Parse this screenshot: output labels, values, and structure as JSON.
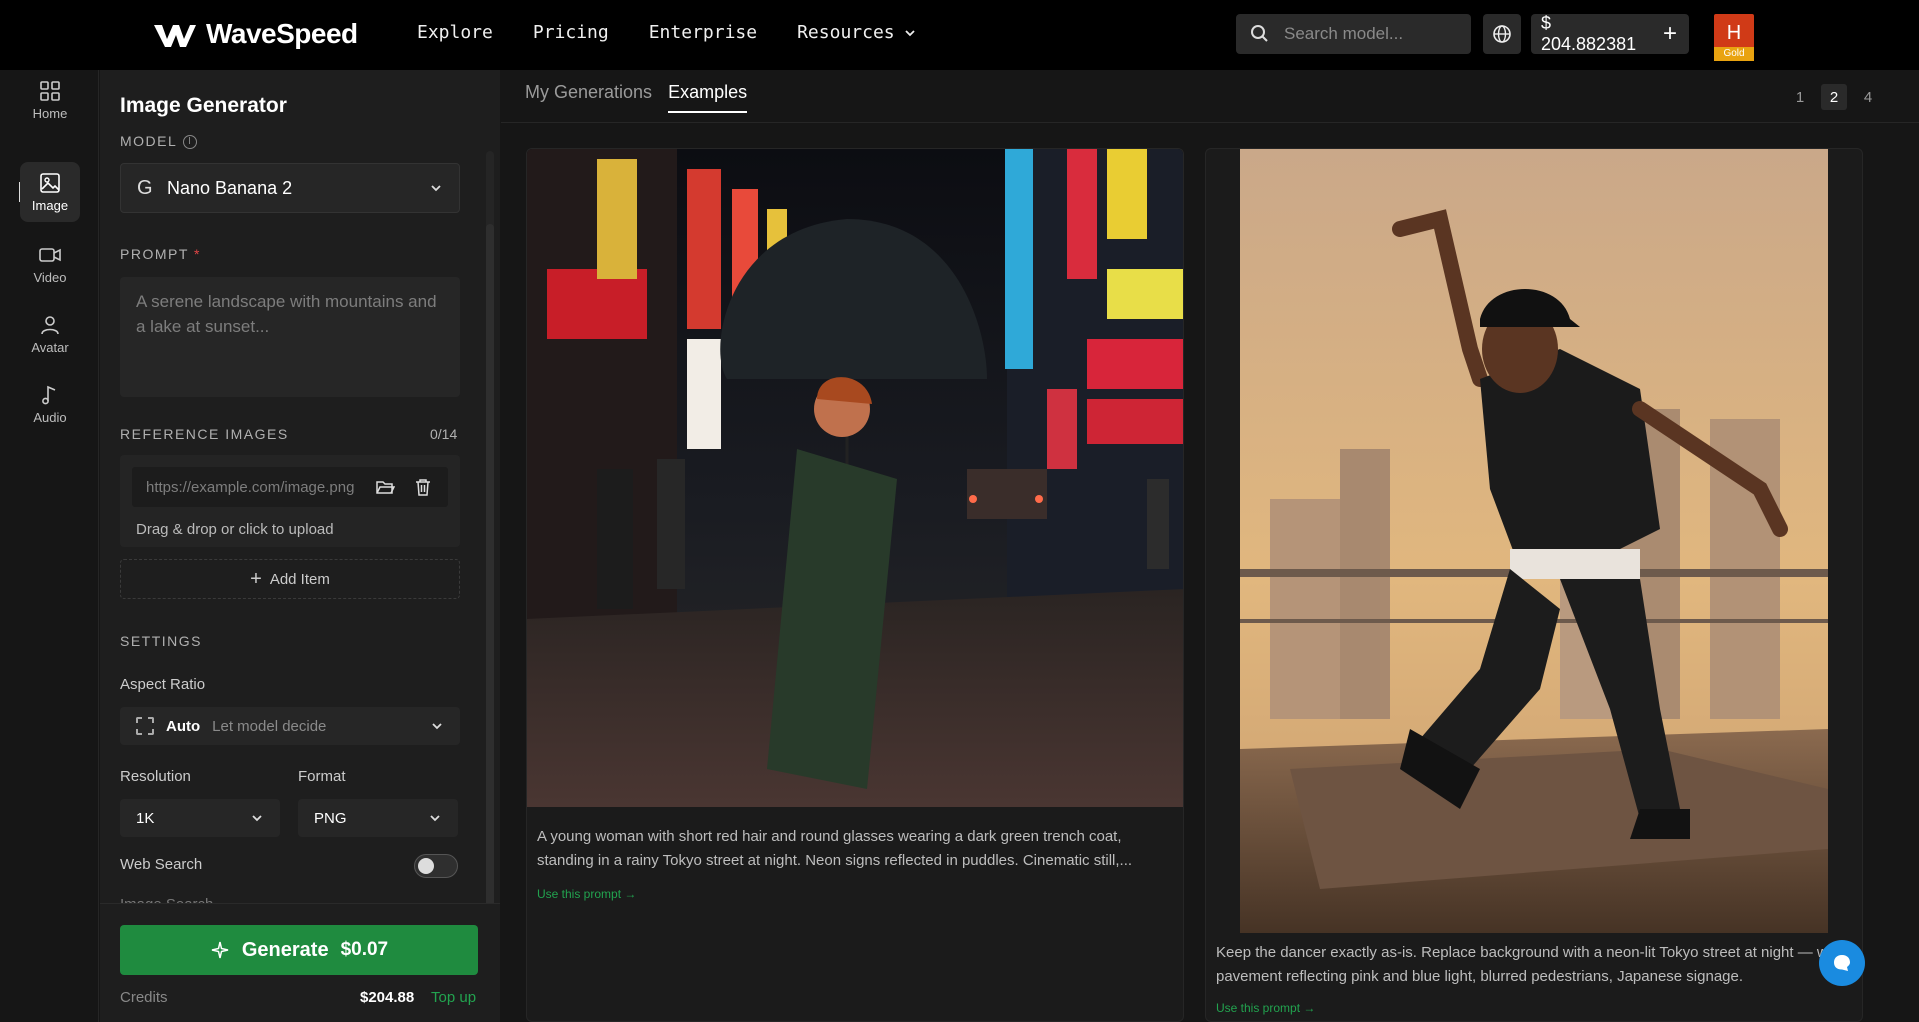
{
  "header": {
    "brand": "WaveSpeed",
    "nav": [
      {
        "label": "Explore"
      },
      {
        "label": "Pricing"
      },
      {
        "label": "Enterprise"
      },
      {
        "label": "Resources"
      }
    ],
    "search_placeholder": "Search model...",
    "balance": "$ 204.882381",
    "avatar_letter": "H",
    "avatar_badge": "Gold"
  },
  "sidenav": [
    {
      "label": "Home",
      "icon": "grid-icon"
    },
    {
      "label": "Image",
      "icon": "image-icon",
      "active": true
    },
    {
      "label": "Video",
      "icon": "video-icon"
    },
    {
      "label": "Avatar",
      "icon": "user-icon"
    },
    {
      "label": "Audio",
      "icon": "music-icon"
    }
  ],
  "panel": {
    "title": "Image Generator",
    "model_label": "MODEL",
    "model_icon": "G",
    "model_value": "Nano Banana 2",
    "prompt_label": "PROMPT",
    "prompt_required": "*",
    "prompt_placeholder": "A serene landscape with mountains and a lake at sunset...",
    "ref_label": "REFERENCE IMAGES",
    "ref_count": "0/14",
    "ref_url_placeholder": "https://example.com/image.png",
    "ref_drag_text": "Drag & drop or click to upload",
    "add_item": "Add Item",
    "settings_label": "SETTINGS",
    "aspect_label": "Aspect Ratio",
    "aspect_value": "Auto",
    "aspect_sub": "Let model decide",
    "resolution_label": "Resolution",
    "resolution_value": "1K",
    "format_label": "Format",
    "format_value": "PNG",
    "web_search_label": "Web Search",
    "web_search_enabled": false,
    "next_toggle_label": "Image Search",
    "generate_label": "Generate",
    "generate_price": "$0.07",
    "credits_label": "Credits",
    "credits_value": "$204.88",
    "topup_label": "Top up"
  },
  "main": {
    "tabs": [
      {
        "label": "My Generations"
      },
      {
        "label": "Examples",
        "active": true
      }
    ],
    "pages": [
      "1",
      "2",
      "4"
    ],
    "active_page": "2",
    "cards": [
      {
        "caption": "A young woman with short red hair and round glasses wearing a dark green trench coat, standing in a rainy Tokyo street at night. Neon signs reflected in puddles. Cinematic still,...",
        "use_prompt": "Use this prompt →"
      },
      {
        "caption": "Keep the dancer exactly as-is. Replace background with a neon-lit Tokyo street at night — wet pavement reflecting pink and blue light, blurred pedestrians, Japanese signage.",
        "use_prompt": "Use this prompt →"
      }
    ]
  },
  "colors": {
    "accent_green": "#1f8b3f",
    "avatar_red": "#d03a17",
    "badge_gold": "#e9a310",
    "chat_blue": "#1a8be0"
  }
}
